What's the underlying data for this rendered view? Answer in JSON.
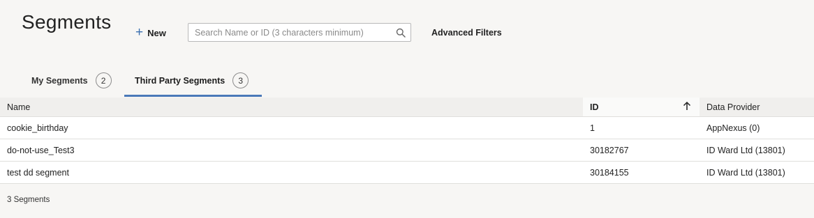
{
  "header": {
    "title": "Segments",
    "new_label": "New",
    "search_placeholder": "Search Name or ID (3 characters minimum)",
    "advanced_filters_label": "Advanced Filters"
  },
  "tabs": [
    {
      "label": "My Segments",
      "count": "2",
      "active": false
    },
    {
      "label": "Third Party Segments",
      "count": "3",
      "active": true
    }
  ],
  "table": {
    "columns": {
      "name": "Name",
      "id": "ID",
      "provider": "Data Provider"
    },
    "sort": {
      "column": "ID",
      "direction": "ascending"
    },
    "rows": [
      {
        "name": "cookie_birthday",
        "id": "1",
        "provider": "AppNexus (0)"
      },
      {
        "name": "do-not-use_Test3",
        "id": "30182767",
        "provider": "ID Ward Ltd (13801)"
      },
      {
        "name": "test dd segment",
        "id": "30184155",
        "provider": "ID Ward Ltd (13801)"
      }
    ]
  },
  "footer": {
    "count_label": "3 Segments"
  },
  "colors": {
    "accent": "#4a79b8",
    "background": "#f7f6f4"
  },
  "icons": [
    "plus-icon",
    "search-icon",
    "sort-arrow-up-icon"
  ]
}
